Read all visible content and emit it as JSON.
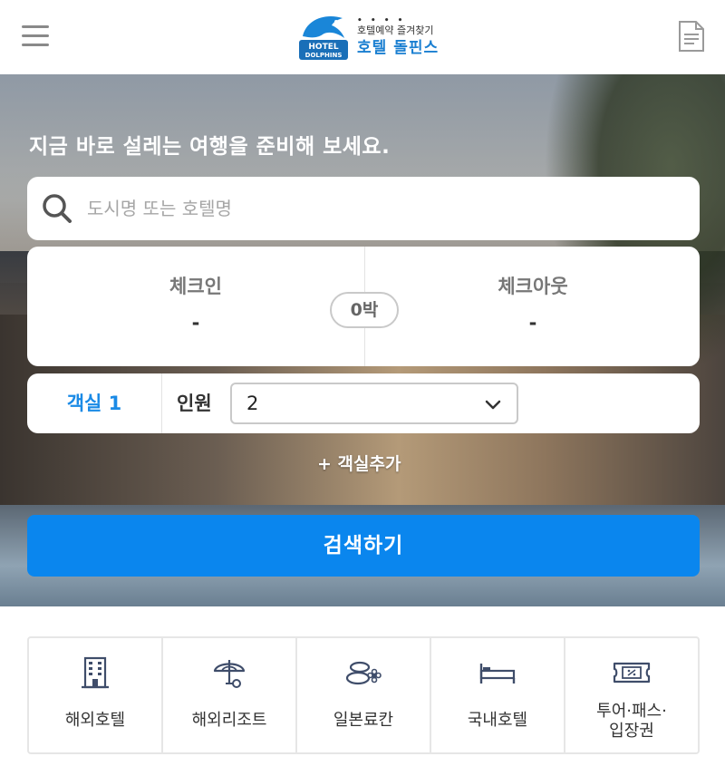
{
  "header": {
    "logo_text_top": "HOTEL",
    "logo_text_bottom": "DOLPHINS",
    "logo_dots": "• • • •",
    "logo_sub": "호텔예약 즐겨찾기",
    "logo_name": "호텔 돌핀스",
    "menu_icon": "hamburger-menu-icon",
    "doc_icon": "document-icon"
  },
  "hero": {
    "title": "지금 바로 설레는 여행을 준비해 보세요.",
    "search_placeholder": "도시명 또는 호텔명",
    "search_value": "",
    "checkin_label": "체크인",
    "checkin_value": "-",
    "checkout_label": "체크아웃",
    "checkout_value": "-",
    "nights": "0박",
    "room_label": "객실 1",
    "guest_label": "인원",
    "guest_value": "2",
    "add_room": "+ 객실추가",
    "search_button": "검색하기"
  },
  "categories": [
    {
      "label": "해외호텔",
      "icon": "hotel-building-icon"
    },
    {
      "label": "해외리조트",
      "icon": "beach-umbrella-icon"
    },
    {
      "label": "일본료칸",
      "icon": "onsen-stones-icon"
    },
    {
      "label": "국내호텔",
      "icon": "bed-icon"
    },
    {
      "label": "투어·패스·\n입장권",
      "icon": "ticket-icon"
    }
  ],
  "colors": {
    "accent": "#0a86ee",
    "room_label": "#1a8ae6",
    "logo_blue": "#1a7fd1"
  }
}
